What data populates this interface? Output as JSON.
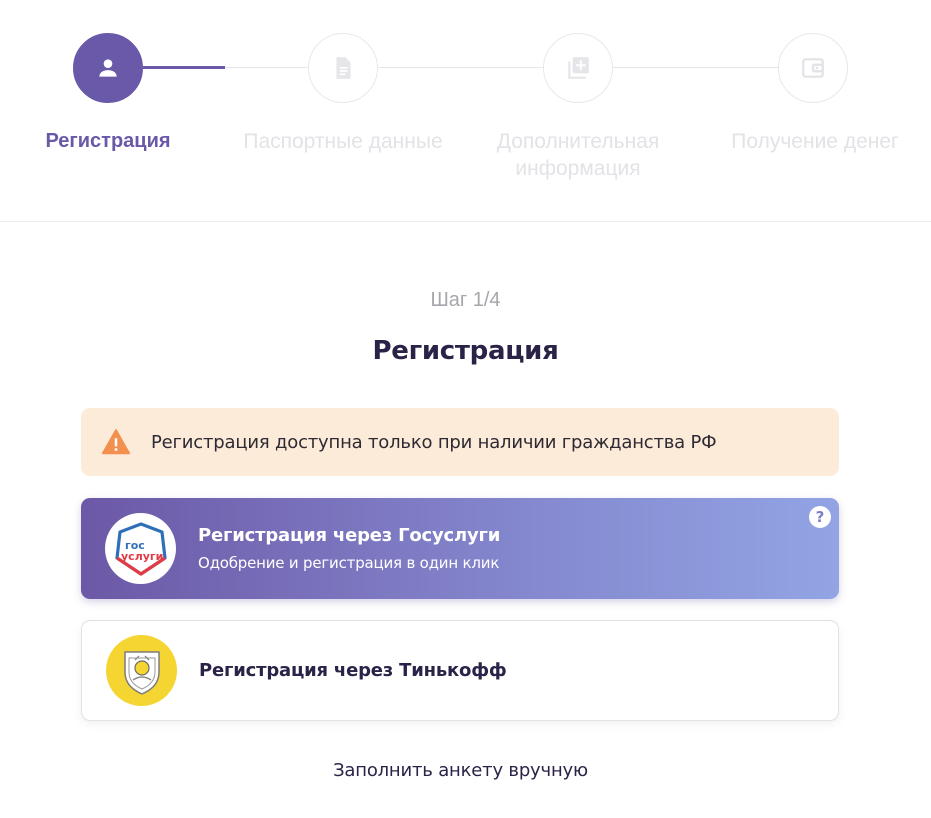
{
  "stepper": {
    "steps": [
      {
        "label": "Регистрация",
        "icon": "user-icon",
        "active": true
      },
      {
        "label": "Паспортные данные",
        "icon": "document-icon",
        "active": false
      },
      {
        "label": "Дополнительная информация",
        "icon": "add-library-icon",
        "active": false
      },
      {
        "label": "Получение денег",
        "icon": "wallet-icon",
        "active": false
      }
    ]
  },
  "main": {
    "step_counter": "Шаг 1/4",
    "title": "Регистрация",
    "warning_text": "Регистрация доступна только при наличии гражданства РФ",
    "gosuslugi": {
      "title": "Регистрация через Госуслуги",
      "subtitle": "Одобрение и регистрация в один клик",
      "logo_line1": "гос",
      "logo_line2": "услуги"
    },
    "tinkoff": {
      "title": "Регистрация через Тинькофф"
    },
    "manual_link": "Заполнить анкету вручную"
  },
  "colors": {
    "accent": "#6a58a8",
    "warning_bg": "#fdebd9",
    "warning_icon": "#f3904f",
    "tinkoff_yellow": "#f5d531"
  }
}
